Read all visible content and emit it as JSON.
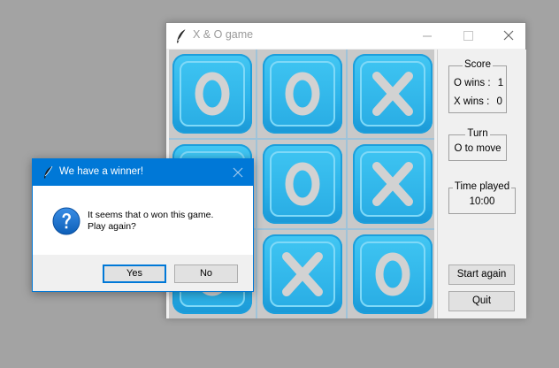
{
  "window": {
    "title": "X & O game"
  },
  "board": {
    "cells": [
      "O",
      "O",
      "X",
      "O",
      "O",
      "X",
      "O",
      "X",
      "O"
    ]
  },
  "score": {
    "title": "Score",
    "o_wins_label": "O wins :",
    "o_wins": "1",
    "x_wins_label": "X wins :",
    "x_wins": "0"
  },
  "turn": {
    "title": "Turn",
    "text": "O to move"
  },
  "time": {
    "title": "Time played",
    "value": "10:00"
  },
  "buttons": {
    "start_again": "Start again",
    "quit": "Quit"
  },
  "dialog": {
    "title": "We have a winner!",
    "line1": "It seems that o won this game.",
    "line2": "Play again?",
    "yes": "Yes",
    "no": "No"
  },
  "colors": {
    "tile": "#2db4ea",
    "mark": "#d2d2d2",
    "dialog_accent": "#0078d7"
  },
  "icons": {
    "app": "feather-icon",
    "dialog": "question-icon"
  }
}
